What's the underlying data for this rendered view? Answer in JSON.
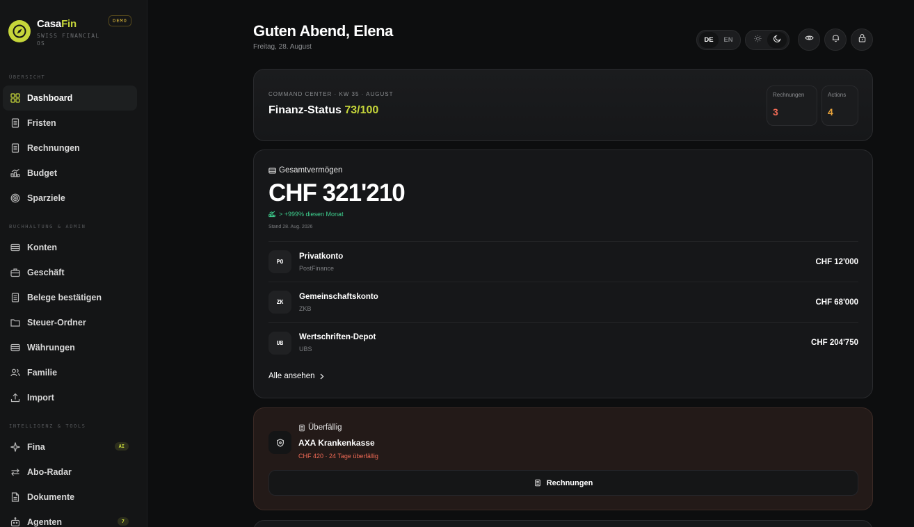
{
  "brand": {
    "name_main": "Casa",
    "name_accent": "Fin",
    "subtitle": "SWISS FINANCIAL OS",
    "badge": "DEMO"
  },
  "sidebar": {
    "sections": [
      {
        "label": "ÜBERSICHT"
      },
      {
        "label": "BUCHHALTUNG & ADMIN"
      },
      {
        "label": "INTELLIGENZ & TOOLS"
      }
    ],
    "items": [
      {
        "label": "Dashboard",
        "icon": "grid-icon",
        "active": true
      },
      {
        "label": "Fristen",
        "icon": "document-icon"
      },
      {
        "label": "Rechnungen",
        "icon": "document-icon"
      },
      {
        "label": "Budget",
        "icon": "trend-icon"
      },
      {
        "label": "Sparziele",
        "icon": "target-icon"
      },
      {
        "label": "Konten",
        "icon": "wallet-icon"
      },
      {
        "label": "Geschäft",
        "icon": "briefcase-icon"
      },
      {
        "label": "Belege bestätigen",
        "icon": "document-icon"
      },
      {
        "label": "Steuer-Ordner",
        "icon": "folder-icon"
      },
      {
        "label": "Währungen",
        "icon": "wallet-icon"
      },
      {
        "label": "Familie",
        "icon": "users-icon"
      },
      {
        "label": "Import",
        "icon": "upload-icon"
      },
      {
        "label": "Fina",
        "icon": "sparkle-icon",
        "badge": "AI"
      },
      {
        "label": "Abo-Radar",
        "icon": "repeat-icon"
      },
      {
        "label": "Dokumente",
        "icon": "file-icon"
      },
      {
        "label": "Agenten",
        "icon": "bot-icon",
        "badge": "7"
      }
    ]
  },
  "header": {
    "greeting": "Guten Abend, Elena",
    "date": "Freitag, 28. August",
    "lang": [
      "DE",
      "EN"
    ],
    "lang_selected": "DE"
  },
  "command_center": {
    "kicker": "COMMAND CENTER · KW 35 · AUGUST",
    "title": "Finanz-Status",
    "score": "73/100",
    "stats": [
      {
        "label": "Rechnungen",
        "value": "3",
        "color": "#f06a55"
      },
      {
        "label": "Actions",
        "value": "4",
        "color": "#e8a23a"
      }
    ]
  },
  "wealth": {
    "title": "Gesamtvermögen",
    "amount": "CHF 321'210",
    "change": "> +999% diesen Monat",
    "as_of": "Stand 28. Aug. 2026",
    "accounts": [
      {
        "initials": "PO",
        "name": "Privatkonto",
        "bank": "PostFinance",
        "amount": "CHF 12'000"
      },
      {
        "initials": "ZK",
        "name": "Gemeinschaftskonto",
        "bank": "ZKB",
        "amount": "CHF 68'000"
      },
      {
        "initials": "UB",
        "name": "Wertschriften-Depot",
        "bank": "UBS",
        "amount": "CHF 204'750"
      }
    ],
    "see_all": "Alle ansehen"
  },
  "overdue": {
    "kicker": "Überfällig",
    "title": "AXA Krankenkasse",
    "subtitle": "CHF 420 · 24 Tage überfällig",
    "button": "Rechnungen"
  }
}
